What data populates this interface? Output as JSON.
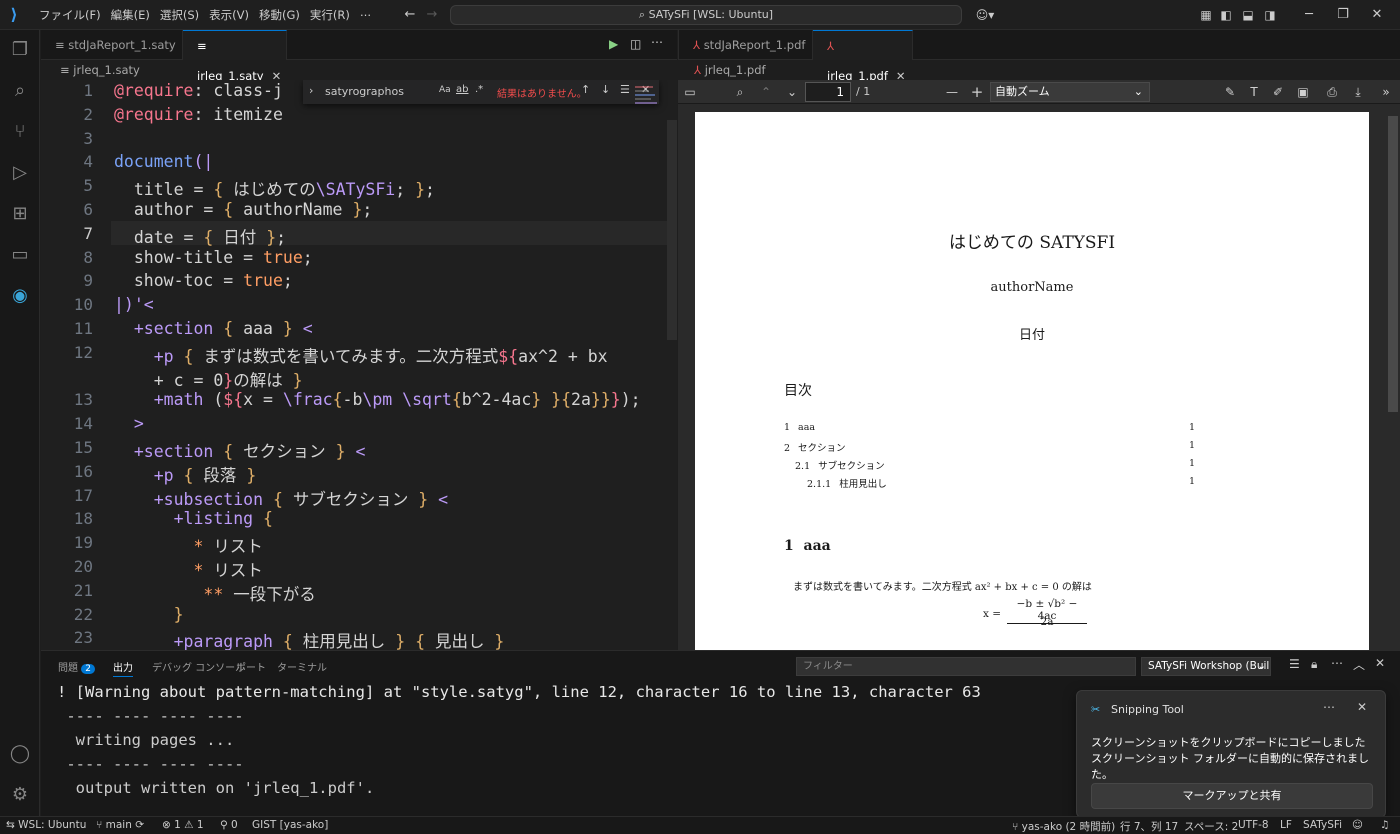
{
  "titlebar": {
    "menus": [
      "ファイル(F)",
      "編集(E)",
      "選択(S)",
      "表示(V)",
      "移動(G)",
      "実行(R)",
      "⋯"
    ],
    "command_center": "SATySFi [WSL: Ubuntu]"
  },
  "editor_tabs": [
    {
      "label": "stdJaReport_1.saty"
    },
    {
      "label": "jrleq_1.saty"
    }
  ],
  "breadcrumb": "jrleq_1.saty",
  "find": {
    "query": "satyrographos",
    "case_label": "Aa",
    "word_label": "ab",
    "regex_label": ".*",
    "result": "結果はありません。"
  },
  "code_lines": [
    {
      "n": "1",
      "segs": [
        [
          "rd",
          "@require"
        ],
        [
          "",
          ": class-j"
        ]
      ]
    },
    {
      "n": "2",
      "segs": [
        [
          "rd",
          "@require"
        ],
        [
          "",
          ": itemize"
        ]
      ]
    },
    {
      "n": "3",
      "segs": []
    },
    {
      "n": "4",
      "segs": [
        [
          "fn",
          "document"
        ],
        [
          "mg",
          "(|"
        ]
      ]
    },
    {
      "n": "5",
      "segs": [
        [
          "",
          "  title = "
        ],
        [
          "br",
          "{"
        ],
        [
          "",
          " はじめての"
        ],
        [
          "mg",
          "\\SATySFi"
        ],
        [
          "",
          "; "
        ],
        [
          "br",
          "}"
        ],
        [
          "",
          ";"
        ]
      ]
    },
    {
      "n": "6",
      "segs": [
        [
          "",
          "  author = "
        ],
        [
          "br",
          "{"
        ],
        [
          "",
          " authorName "
        ],
        [
          "br",
          "}"
        ],
        [
          "",
          ";"
        ]
      ]
    },
    {
      "n": "7",
      "segs": [
        [
          "",
          "  date = "
        ],
        [
          "br",
          "{"
        ],
        [
          "",
          " 日付 "
        ],
        [
          "br",
          "}"
        ],
        [
          "",
          ";"
        ]
      ]
    },
    {
      "n": "8",
      "segs": [
        [
          "",
          "  show-title = "
        ],
        [
          "kw",
          "true"
        ],
        [
          "",
          ";"
        ]
      ]
    },
    {
      "n": "9",
      "segs": [
        [
          "",
          "  show-toc = "
        ],
        [
          "kw",
          "true"
        ],
        [
          "",
          ";"
        ]
      ]
    },
    {
      "n": "10",
      "segs": [
        [
          "mg",
          "|)'<"
        ]
      ]
    },
    {
      "n": "11",
      "segs": [
        [
          "mg",
          "  +section"
        ],
        [
          "",
          " "
        ],
        [
          "br",
          "{"
        ],
        [
          "",
          " aaa "
        ],
        [
          "br",
          "}"
        ],
        [
          "",
          " "
        ],
        [
          "mg",
          "<"
        ]
      ]
    },
    {
      "n": "12",
      "segs": [
        [
          "mg",
          "    +p"
        ],
        [
          "",
          " "
        ],
        [
          "br",
          "{"
        ],
        [
          "",
          " まずは数式を書いてみます。二次方程式"
        ],
        [
          "rd",
          "${"
        ],
        [
          "",
          "ax^2 + bx"
        ]
      ]
    },
    {
      "n": "",
      "segs": [
        [
          "",
          "    + c = 0"
        ],
        [
          "rd",
          "}"
        ],
        [
          "",
          "の解は "
        ],
        [
          "br",
          "}"
        ]
      ]
    },
    {
      "n": "13",
      "segs": [
        [
          "mg",
          "    +math"
        ],
        [
          "",
          " ("
        ],
        [
          "rd",
          "${"
        ],
        [
          "",
          "x = "
        ],
        [
          "mg",
          "\\frac"
        ],
        [
          "br",
          "{"
        ],
        [
          "",
          "-b"
        ],
        [
          "mg",
          "\\pm"
        ],
        [
          "",
          " "
        ],
        [
          "mg",
          "\\sqrt"
        ],
        [
          "br",
          "{"
        ],
        [
          "",
          "b^2-4ac"
        ],
        [
          "br",
          "}"
        ],
        [
          "",
          " "
        ],
        [
          "br",
          "}{"
        ],
        [
          "",
          "2a"
        ],
        [
          "br",
          "}}"
        ],
        [
          "rd",
          "}"
        ],
        [
          "",
          ");"
        ]
      ]
    },
    {
      "n": "14",
      "segs": [
        [
          "mg",
          "  >"
        ]
      ]
    },
    {
      "n": "15",
      "segs": [
        [
          "mg",
          "  +section"
        ],
        [
          "",
          " "
        ],
        [
          "br",
          "{"
        ],
        [
          "",
          " セクション "
        ],
        [
          "br",
          "}"
        ],
        [
          "",
          " "
        ],
        [
          "mg",
          "<"
        ]
      ]
    },
    {
      "n": "16",
      "segs": [
        [
          "mg",
          "    +p"
        ],
        [
          "",
          " "
        ],
        [
          "br",
          "{"
        ],
        [
          "",
          " 段落 "
        ],
        [
          "br",
          "}"
        ]
      ]
    },
    {
      "n": "17",
      "segs": [
        [
          "mg",
          "    +subsection"
        ],
        [
          "",
          " "
        ],
        [
          "br",
          "{"
        ],
        [
          "",
          " サブセクション "
        ],
        [
          "br",
          "}"
        ],
        [
          "",
          " "
        ],
        [
          "mg",
          "<"
        ]
      ]
    },
    {
      "n": "18",
      "segs": [
        [
          "mg",
          "      +listing"
        ],
        [
          "",
          " "
        ],
        [
          "br",
          "{"
        ]
      ]
    },
    {
      "n": "19",
      "segs": [
        [
          "",
          "        "
        ],
        [
          "kw",
          "*"
        ],
        [
          "",
          " リスト"
        ]
      ]
    },
    {
      "n": "20",
      "segs": [
        [
          "",
          "        "
        ],
        [
          "kw",
          "*"
        ],
        [
          "",
          " リスト"
        ]
      ]
    },
    {
      "n": "21",
      "segs": [
        [
          "",
          "         "
        ],
        [
          "kw",
          "**"
        ],
        [
          "",
          " 一段下がる"
        ]
      ]
    },
    {
      "n": "22",
      "segs": [
        [
          "",
          "      "
        ],
        [
          "br",
          "}"
        ]
      ]
    },
    {
      "n": "23",
      "segs": [
        [
          "mg",
          "      +paragraph"
        ],
        [
          "",
          " "
        ],
        [
          "br",
          "{"
        ],
        [
          "",
          " 柱用見出し "
        ],
        [
          "br",
          "}"
        ],
        [
          "",
          " "
        ],
        [
          "br",
          "{"
        ],
        [
          "",
          " 見出し "
        ],
        [
          "br",
          "}"
        ]
      ]
    }
  ],
  "pdf_tabs": [
    {
      "label": "stdJaReport_1.pdf"
    },
    {
      "label": "jrleq_1.pdf"
    }
  ],
  "pdf_breadcrumb": "jrleq_1.pdf",
  "pdf_toolbar": {
    "page": "1",
    "page_total": "/ 1",
    "zoom": "自動ズーム"
  },
  "pdf_page": {
    "title": "はじめての SATYSFI",
    "author": "authorName",
    "date": "日付",
    "toc_heading": "目次",
    "toc": [
      {
        "num": "1",
        "label": "aaa",
        "page": "1"
      },
      {
        "num": "2",
        "label": "セクション",
        "page": "1"
      },
      {
        "num": "2.1",
        "label": "サブセクション",
        "page": "1"
      },
      {
        "num": "2.1.1",
        "label": "柱用見出し",
        "page": "1"
      }
    ],
    "section_num": "1",
    "section_title": "aaa",
    "body": "まずは数式を書いてみます。二次方程式 ax² + bx + c = 0 の解は",
    "formula_lhs": "x =",
    "formula_num": "−b ± √b² − 4ac",
    "formula_den": "2a"
  },
  "panel": {
    "tabs": [
      "問題",
      "出力",
      "デバッグ コンソール",
      "ポート",
      "ターミナル"
    ],
    "problem_count": "2",
    "filter_placeholder": "フィルター",
    "channel": "SATySFi Workshop (Buil",
    "output": [
      "! [Warning about pattern-matching] at \"style.satyg\", line 12, character 16 to line 13, character 63",
      " ---- ---- ---- ----",
      "  writing pages ...",
      " ---- ---- ---- ----",
      "  output written on 'jrleq_1.pdf'."
    ]
  },
  "toast": {
    "app": "Snipping Tool",
    "line1": "スクリーンショットをクリップボードにコピーしました",
    "line2": "スクリーンショット フォルダーに自動的に保存されました。",
    "button": "マークアップと共有"
  },
  "statusbar": {
    "remote": "WSL: Ubuntu",
    "branch": "main",
    "errors": "1",
    "warnings": "1",
    "ports": "0",
    "gist": "GIST [yas-ako]",
    "blame": "yas-ako (2 時間前)",
    "position": "行 7、列 17",
    "spaces": "スペース: 2",
    "encoding": "UTF-8",
    "eol": "LF",
    "language": "SATySFi"
  },
  "colors": {
    "accent": "#0078d4",
    "badge": "#0078d4",
    "warning_red": "#f14c4c"
  }
}
